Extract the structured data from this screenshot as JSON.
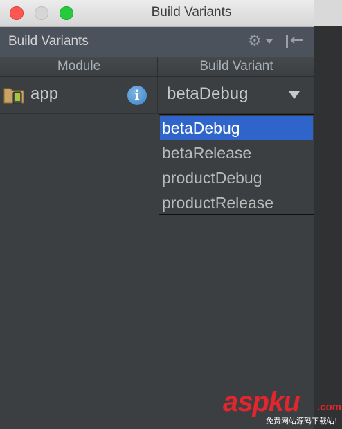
{
  "window": {
    "title": "Build Variants"
  },
  "tool_window": {
    "title": "Build Variants",
    "icons": [
      "gear-icon",
      "hide-panel-icon"
    ]
  },
  "table": {
    "columns": [
      "Module",
      "Build Variant"
    ],
    "rows": [
      {
        "module": "app",
        "variant": "betaDebug",
        "module_icon": "android-module-folder-icon",
        "status_icon": "info-icon"
      }
    ]
  },
  "dropdown": {
    "options": [
      "betaDebug",
      "betaRelease",
      "productDebug",
      "productRelease"
    ],
    "selected_index": 0
  },
  "watermark": {
    "brand": "aspku",
    "suffix": ".com",
    "tagline": "免费网站源码下载站!"
  },
  "colors": {
    "selection": "#2f65ca",
    "close": "#fc5753",
    "maximize": "#27c93f",
    "watermark": "#e3262e"
  }
}
